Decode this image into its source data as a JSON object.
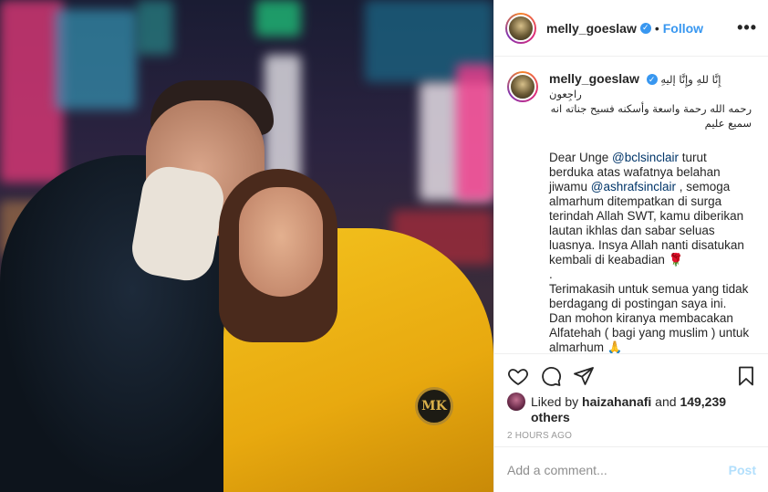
{
  "post": {
    "username": "melly_goeslaw",
    "dot": "•",
    "follow_label": "Follow",
    "more_label": "•••",
    "verified_glyph": "✓"
  },
  "caption": {
    "username": "melly_goeslaw",
    "arabic_line1": "إِنَّا للهِ وإِنَّا إليهِ راجِعون",
    "arabic_line2": "رحمه الله رحمة واسعة وأسكنه فسيح جناته انه سميع عليم",
    "text_part1": "Dear Unge ",
    "mention1": "@bclsinclair",
    "text_part2": " turut berduka atas wafatnya belahan jiwamu ",
    "mention2": "@ashrafsinclair",
    "text_part3": " , semoga almarhum ditempatkan di surga terindah Allah SWT, kamu diberikan lautan ikhlas dan sabar seluas luasnya. Insya Allah nanti disatukan kembali di keabadian 🌹\n.\nTerimakasih untuk semua yang tidak berdagang di postingan saya ini.\nDan mohon kiranya membacakan Alfatehah ( bagi yang muslim ) untuk almarhum 🙏"
  },
  "actions": {
    "like_icon": "heart-icon",
    "comment_icon": "speech-bubble-icon",
    "share_icon": "paper-plane-icon",
    "save_icon": "bookmark-icon"
  },
  "likes": {
    "prefix": "Liked by ",
    "user": "haizahanafi",
    "middle": " and ",
    "count": "149,239 others"
  },
  "timestamp": "2 HOURS AGO",
  "add_comment": {
    "placeholder": "Add a comment...",
    "post_label": "Post"
  },
  "photo": {
    "badge_text": "MK"
  },
  "colors": {
    "accent": "#3897f0",
    "post_disabled": "#b2dffc",
    "border": "#efefef"
  }
}
